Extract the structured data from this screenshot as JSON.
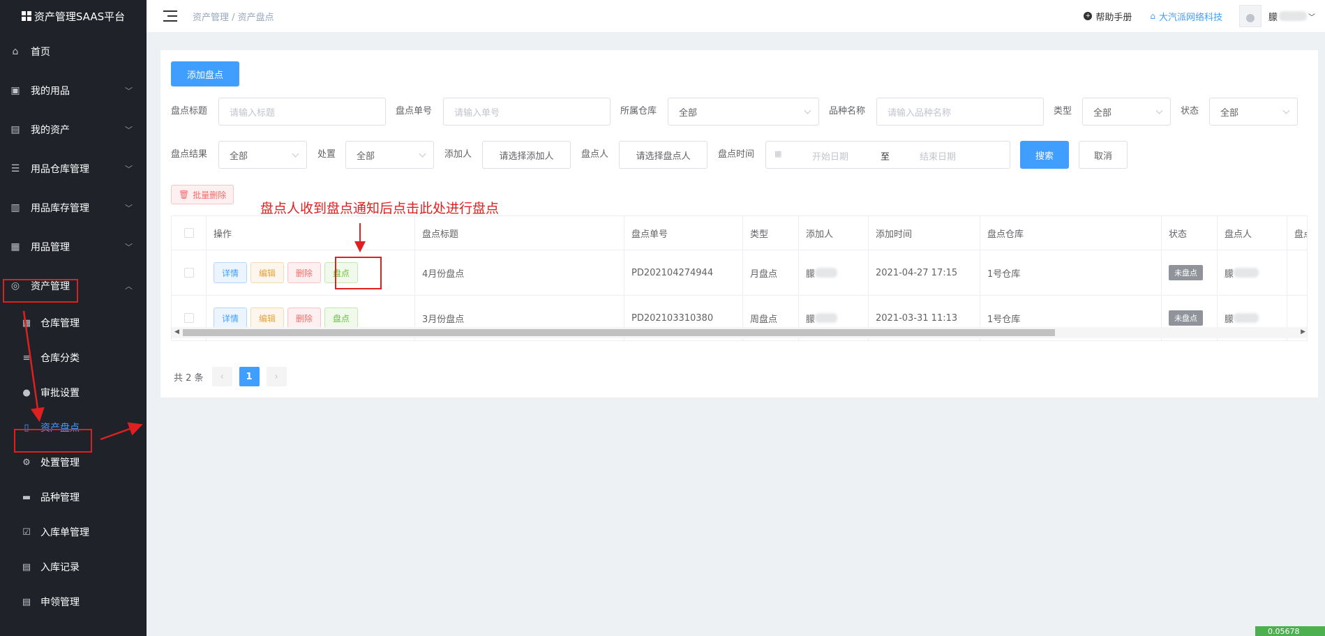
{
  "app": {
    "title": "资产管理SAAS平台"
  },
  "sidebar": {
    "items": [
      {
        "label": "首页",
        "icon": "home-icon"
      },
      {
        "label": "我的用品",
        "icon": "bag-icon"
      },
      {
        "label": "我的资产",
        "icon": "building-icon"
      },
      {
        "label": "用品仓库管理",
        "icon": "database-icon"
      },
      {
        "label": "用品库存管理",
        "icon": "box-icon"
      },
      {
        "label": "用品管理",
        "icon": "suitcase-icon"
      },
      {
        "label": "资产管理",
        "icon": "asset-icon"
      }
    ],
    "sub_items": [
      {
        "label": "仓库管理",
        "icon": "warehouse-icon"
      },
      {
        "label": "仓库分类",
        "icon": "category-icon"
      },
      {
        "label": "审批设置",
        "icon": "user-icon"
      },
      {
        "label": "资产盘点",
        "icon": "document-icon"
      },
      {
        "label": "处置管理",
        "icon": "gear-icon"
      },
      {
        "label": "品种管理",
        "icon": "package-icon"
      },
      {
        "label": "入库单管理",
        "icon": "clipboard-check-icon"
      },
      {
        "label": "入库记录",
        "icon": "clipboard-icon"
      },
      {
        "label": "申领管理",
        "icon": "clipboard-list-icon"
      }
    ]
  },
  "header": {
    "breadcrumb": "资产管理 / 资产盘点",
    "help": "帮助手册",
    "company": "大汽派网络科技",
    "user": "朦"
  },
  "toolbar": {
    "add_label": "添加盘点",
    "batch_delete": "批量删除"
  },
  "filters": {
    "title_label": "盘点标题",
    "title_placeholder": "请输入标题",
    "number_label": "盘点单号",
    "number_placeholder": "请输入单号",
    "warehouse_label": "所属仓库",
    "warehouse_value": "全部",
    "variety_label": "品种名称",
    "variety_placeholder": "请输入品种名称",
    "type_label": "类型",
    "type_value": "全部",
    "status_label": "状态",
    "status_value": "全部",
    "result_label": "盘点结果",
    "result_value": "全部",
    "dispose_label": "处置",
    "dispose_value": "全部",
    "adder_label": "添加人",
    "adder_value": "请选择添加人",
    "checker_label": "盘点人",
    "checker_value": "请选择盘点人",
    "time_label": "盘点时间",
    "start_placeholder": "开始日期",
    "range_sep": "至",
    "end_placeholder": "结束日期",
    "search": "搜索",
    "cancel": "取消"
  },
  "annotation": "盘点人收到盘点通知后点击此处进行盘点",
  "table": {
    "columns": [
      "操作",
      "盘点标题",
      "盘点单号",
      "类型",
      "添加人",
      "添加时间",
      "盘点仓库",
      "状态",
      "盘点人",
      "盘点"
    ],
    "actions": {
      "detail": "详情",
      "edit": "编辑",
      "delete": "删除",
      "check": "盘点"
    },
    "rows": [
      {
        "title": "4月份盘点",
        "number": "PD202104274944",
        "type": "月盘点",
        "adder": "朦",
        "time": "2021-04-27 17:15",
        "warehouse": "1号仓库",
        "status": "未盘点",
        "checker": "朦"
      },
      {
        "title": "3月份盘点",
        "number": "PD202103310380",
        "type": "周盘点",
        "adder": "朦",
        "time": "2021-03-31 11:13",
        "warehouse": "1号仓库",
        "status": "未盘点",
        "checker": "朦"
      }
    ]
  },
  "pagination": {
    "total": "共 2 条",
    "current": "1"
  },
  "corner_badge": "0.05678"
}
